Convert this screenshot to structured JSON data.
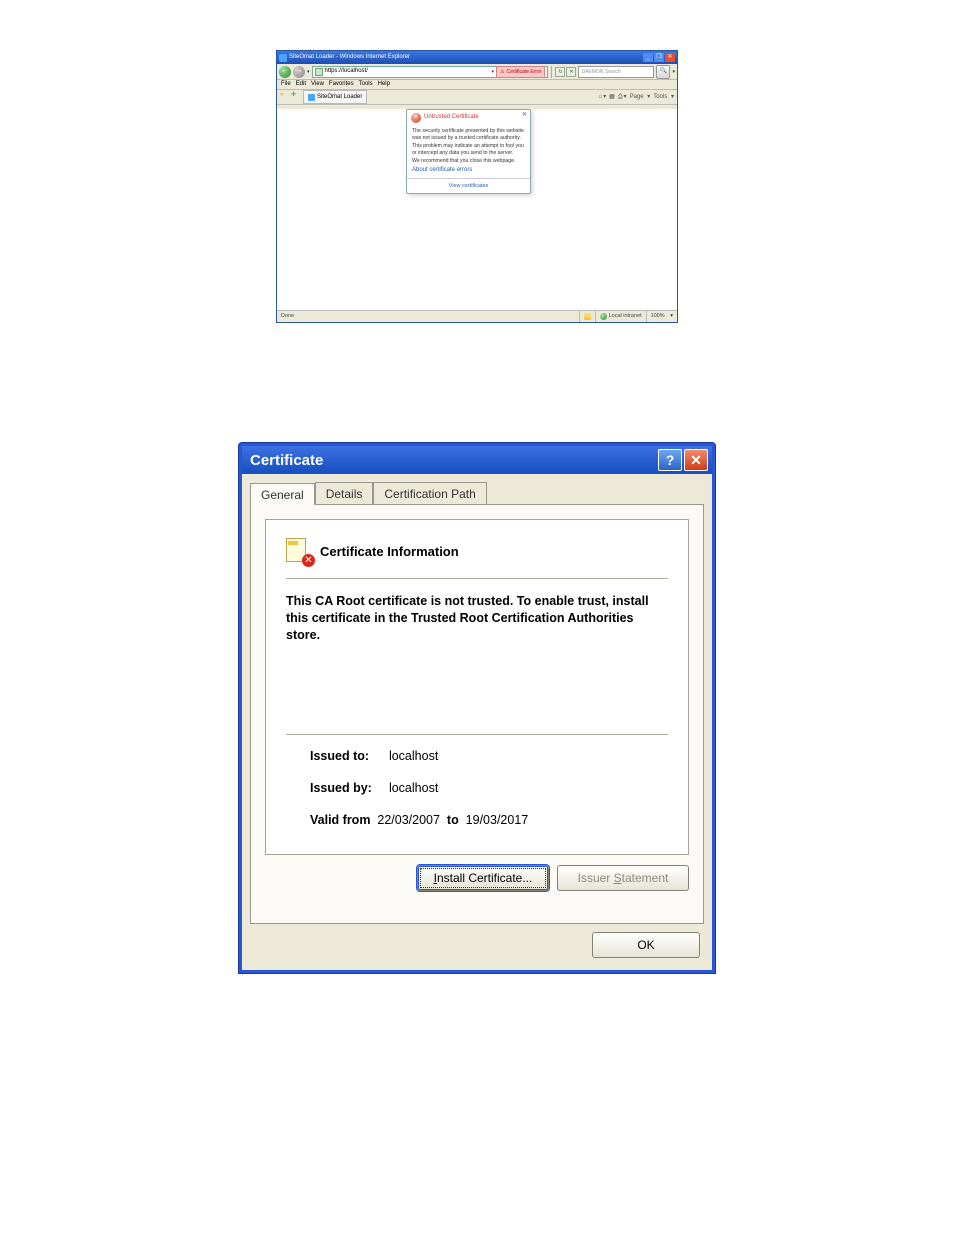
{
  "ie": {
    "window_title": "SiteOmat Loader - Windows Internet Explorer",
    "win_buttons": {
      "min": "_",
      "max": "❐",
      "close": "✕"
    },
    "nav": {
      "back": "←",
      "fwd": "→",
      "dd": "▾"
    },
    "url": "https://localhost/",
    "cert_error_label": "Certificate Error",
    "cert_error_dd": "▾",
    "search_placeholder": "DAEMON Search",
    "refresh": "↻",
    "stop": "✕",
    "mag": "🔍",
    "menubar": [
      "File",
      "Edit",
      "View",
      "Favorites",
      "Tools",
      "Help"
    ],
    "fav_star": "★",
    "fav_add": "✚",
    "tab_label": "SiteOmat Loader",
    "toolbar": {
      "home": "⌂",
      "feeds": "▦",
      "print": "⎙",
      "page": "Page",
      "tools": "Tools",
      "dd": "▾"
    },
    "callout": {
      "close": "✕",
      "title": "Untrusted Certificate",
      "p1": "The security certificate presented by this website was not issued by a trusted certificate authority.",
      "p2": "This problem may indicate an attempt to fool you or intercept any data you send to the server.",
      "p3": "We recommend that you close this webpage.",
      "link": "About certificate errors",
      "view": "View certificates"
    },
    "status": {
      "done": "Done",
      "zone": "Local intranet",
      "zoom": "100%",
      "zoomdd": "▾"
    }
  },
  "cert": {
    "title": "Certificate",
    "help": "?",
    "close": "✕",
    "tabs": {
      "general": "General",
      "details": "Details",
      "path": "Certification Path"
    },
    "info_header": "Certificate Information",
    "info_icon_x": "✕",
    "message": "This CA Root certificate is not trusted. To enable trust, install this certificate in the Trusted Root Certification Authorities store.",
    "issued_to_label": "Issued to:",
    "issued_to_value": "localhost",
    "issued_by_label": "Issued by:",
    "issued_by_value": "localhost",
    "valid_label": "Valid from",
    "valid_from": "22/03/2007",
    "valid_to_label": "to",
    "valid_to": "19/03/2017",
    "btn_install": "Install Certificate...",
    "btn_install_ul": "I",
    "btn_issuer": "Issuer Statement",
    "btn_issuer_ul": "S",
    "btn_ok": "OK"
  }
}
